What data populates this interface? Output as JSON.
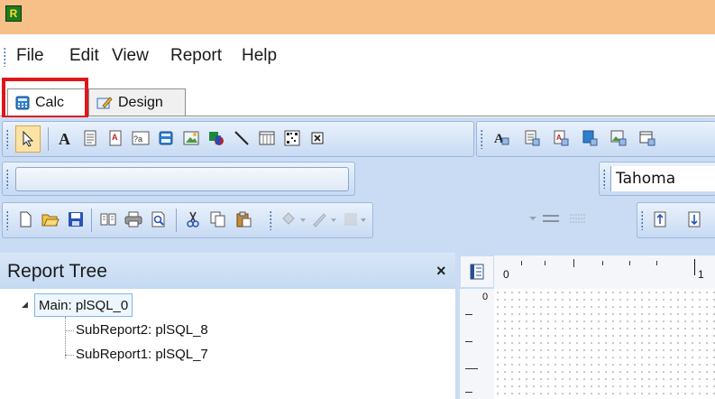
{
  "menu": {
    "items": [
      "File",
      "Edit",
      "View",
      "Report",
      "Help"
    ]
  },
  "tabs": [
    {
      "label": "Calc",
      "icon": "calculator-icon",
      "active": true
    },
    {
      "label": "Design",
      "icon": "design-pencil-icon",
      "active": false
    }
  ],
  "format_toolbar": {
    "font_name": "Tahoma"
  },
  "report_tree": {
    "title": "Report Tree",
    "close_symbol": "×",
    "root": "Main: plSQL_0",
    "children": [
      "SubReport2: plSQL_8",
      "SubReport1: plSQL_7"
    ]
  },
  "ruler": {
    "h_zero": "0",
    "h_one": "1",
    "v_zero": "0"
  },
  "colors": {
    "title_bar": "#f6c088",
    "highlight": "#e0161b",
    "toolbar_bg": "#c9dcf3"
  }
}
